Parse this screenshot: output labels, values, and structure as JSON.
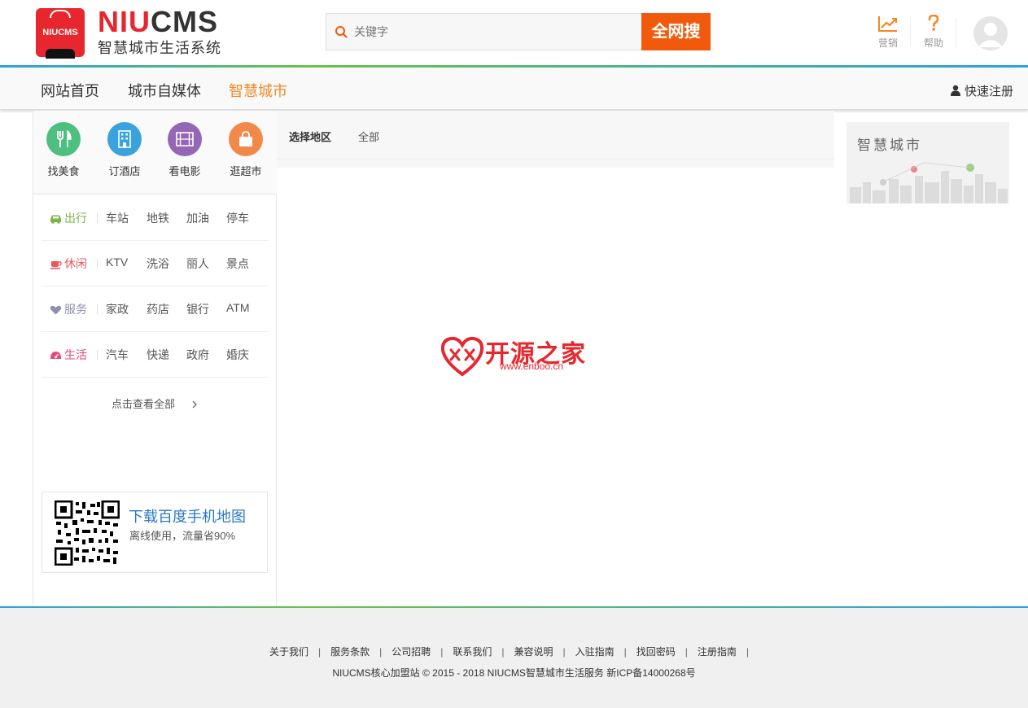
{
  "header": {
    "logo_badge_text": "NIUCMS",
    "logo_word_red": "NIU",
    "logo_word_dark": "CMS",
    "logo_subtitle": "智慧城市生活系统",
    "search_placeholder": "关键字",
    "search_button": "全网搜",
    "tools": [
      {
        "label": "营销",
        "icon": "chart-up-icon"
      },
      {
        "label": "帮助",
        "icon": "question-icon"
      }
    ],
    "avatar_icon": "user-avatar-icon"
  },
  "nav": {
    "items": [
      {
        "label": "网站首页",
        "active": false
      },
      {
        "label": "城市自媒体",
        "active": false
      },
      {
        "label": "智慧城市",
        "active": true
      }
    ],
    "register": "快速注册"
  },
  "sidebar": {
    "quick_links": [
      {
        "label": "找美食",
        "icon": "fork-knife-icon",
        "color": "#4dbf7e"
      },
      {
        "label": "订酒店",
        "icon": "building-icon",
        "color": "#3aa3dd"
      },
      {
        "label": "看电影",
        "icon": "film-icon",
        "color": "#9466b6"
      },
      {
        "label": "逛超市",
        "icon": "shopping-bag-icon",
        "color": "#f2894b"
      }
    ],
    "categories": [
      {
        "name": "出行",
        "icon": "car-icon",
        "color": "#7ab648",
        "links": [
          "车站",
          "地铁",
          "加油",
          "停车"
        ]
      },
      {
        "name": "休闲",
        "icon": "coffee-icon",
        "color": "#e8595c",
        "links": [
          "KTV",
          "洗浴",
          "丽人",
          "景点"
        ]
      },
      {
        "name": "服务",
        "icon": "heart-icon",
        "color": "#8e8eb0",
        "links": [
          "家政",
          "药店",
          "银行",
          "ATM"
        ]
      },
      {
        "name": "生活",
        "icon": "gauge-icon",
        "color": "#e8467c",
        "links": [
          "汽车",
          "快递",
          "政府",
          "婚庆"
        ]
      }
    ],
    "see_all": "点击查看全部",
    "qr": {
      "title": "下载百度手机地图",
      "subtitle": "离线使用，流量省90%"
    }
  },
  "main": {
    "filter_label": "选择地区",
    "filter_value": "全部",
    "watermark_text": "开源之家",
    "watermark_url": "www.enboo.cn"
  },
  "banner": {
    "title": "智慧城市"
  },
  "footer": {
    "links": [
      "关于我们",
      "服务条款",
      "公司招聘",
      "联系我们",
      "兼容说明",
      "入驻指南",
      "找回密码",
      "注册指南"
    ],
    "copyright": "NIUCMS核心加盟站 © 2015 - 2018 NIUCMS智慧城市生活服务 新ICP备14000268号"
  },
  "colors": {
    "brand_red": "#e8262d",
    "search_orange": "#f15a0c",
    "nav_active": "#f08a24",
    "link_blue": "#2b78c5"
  }
}
